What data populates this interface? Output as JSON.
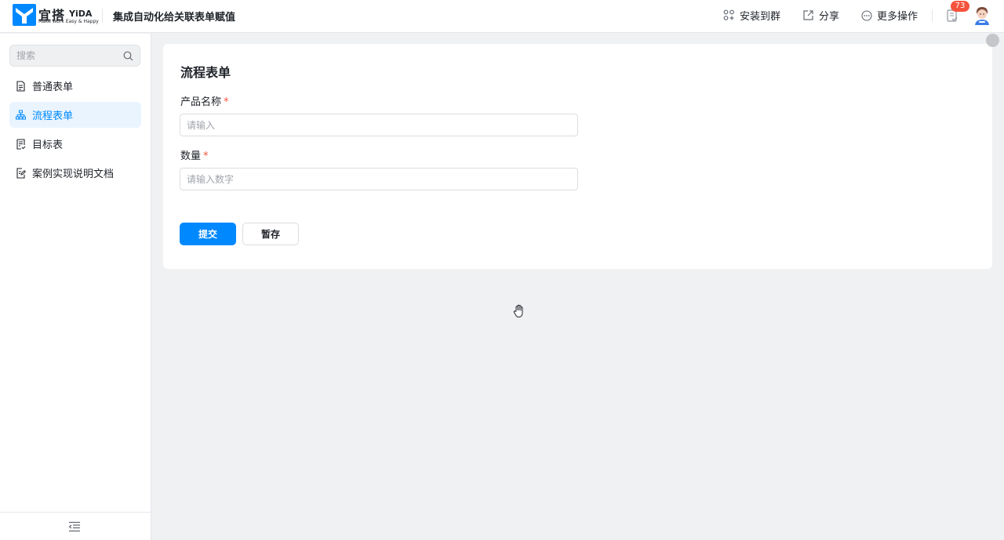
{
  "header": {
    "brand_cn": "宜搭",
    "brand_en": "YiDA",
    "brand_tagline": "Make Work Easy & Happy",
    "app_title": "集成自动化给关联表单赋值",
    "actions": {
      "install": "安装到群",
      "share": "分享",
      "more": "更多操作"
    },
    "todo_badge": "73"
  },
  "sidebar": {
    "search_placeholder": "搜索",
    "items": [
      {
        "label": "普通表单",
        "icon": "document-icon"
      },
      {
        "label": "流程表单",
        "icon": "flow-icon"
      },
      {
        "label": "目标表",
        "icon": "report-icon"
      },
      {
        "label": "案例实现说明文档",
        "icon": "edit-doc-icon"
      }
    ],
    "active_index": 1
  },
  "form": {
    "title": "流程表单",
    "fields": [
      {
        "label": "产品名称",
        "required_mark": "*",
        "placeholder": "请输入"
      },
      {
        "label": "数量",
        "required_mark": "*",
        "placeholder": "请输入数字"
      }
    ],
    "submit_label": "提交",
    "draft_label": "暂存"
  },
  "colors": {
    "accent": "#0089ff",
    "required": "#f5533d",
    "badge": "#f5533d",
    "active_bg": "#e9f4ff",
    "page_bg": "#f0f1f3"
  }
}
